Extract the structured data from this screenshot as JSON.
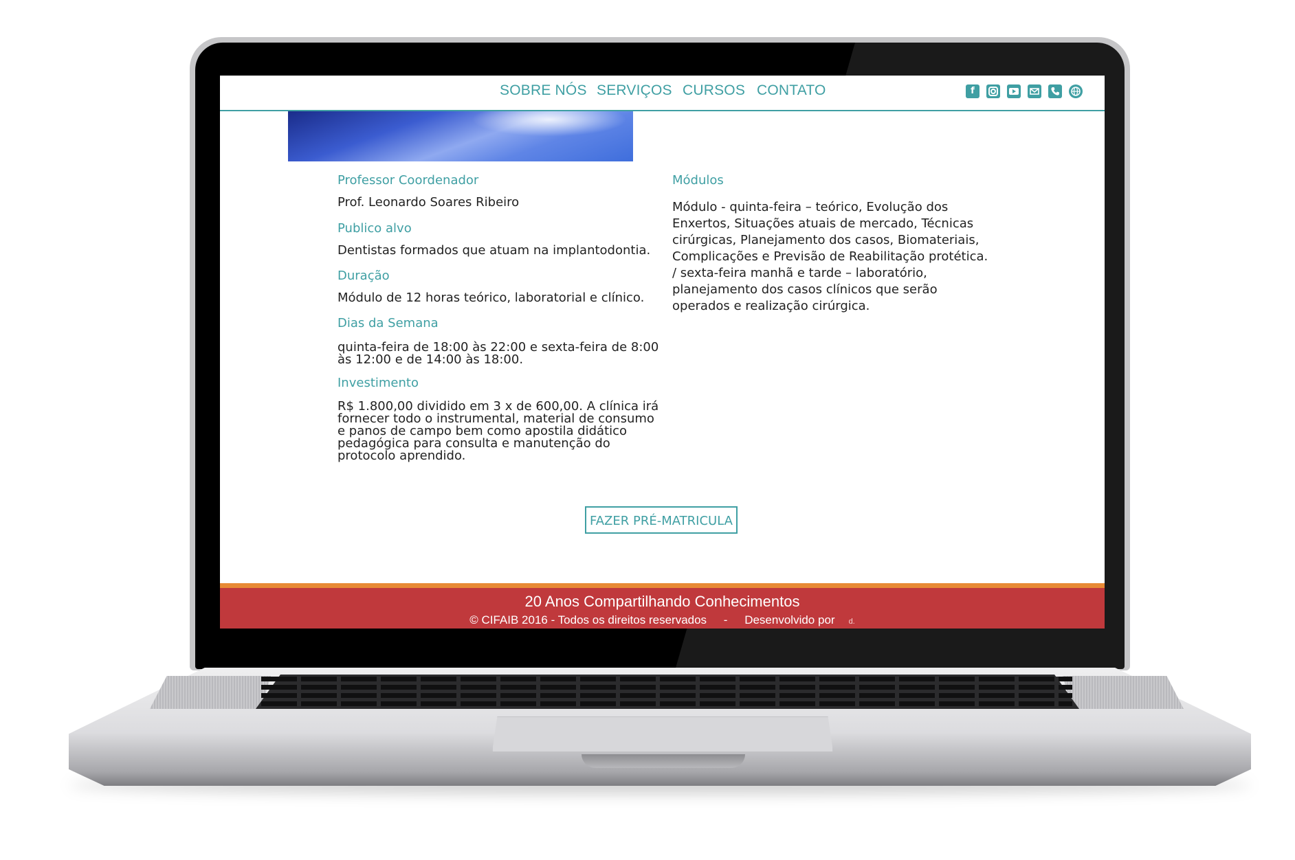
{
  "nav": {
    "links": [
      "SOBRE NÓS",
      "SERVIÇOS",
      "CURSOS",
      "CONTATO"
    ],
    "social_icons": [
      "facebook-icon",
      "instagram-icon",
      "youtube-icon",
      "email-icon",
      "phone-icon",
      "globe-icon"
    ]
  },
  "course": {
    "coordinator_label": "Professor Coordenador",
    "coordinator": "Prof. Leonardo Soares Ribeiro",
    "audience_label": "Publico alvo",
    "audience": "Dentistas formados que atuam na implantodontia.",
    "duration_label": "Duração",
    "duration": "Módulo de 12 horas teórico, laboratorial e clínico.",
    "days_label": "Dias da Semana",
    "days": "quinta-feira de 18:00 às 22:00 e sexta-feira de 8:00 às 12:00 e de 14:00 às 18:00.",
    "investment_label": "Investimento",
    "investment": "R$ 1.800,00 dividido em 3 x de 600,00. A clínica irá fornecer todo o instrumental, material de consumo e panos de campo bem como apostila didático pedagógica para consulta e manutenção do protocolo aprendido.",
    "modules_label": "Módulos",
    "modules": "Módulo - quinta-feira – teórico, Evolução dos Enxertos, Situações atuais de mercado, Técnicas cirúrgicas, Planejamento dos casos, Biomateriais, Complicações e Previsão de Reabilitação protética. / sexta-feira manhã e tarde – laboratório, planejamento dos casos clínicos que serão operados e realização cirúrgica."
  },
  "cta": {
    "label": "FAZER PRÉ-MATRICULA"
  },
  "footer": {
    "tagline": "20 Anos Compartilhando Conhecimentos",
    "copyright": "© CIFAIB 2016 - Todos os direitos reservados",
    "separator": "-",
    "developed_by": "Desenvolvido por",
    "developer_logo_text": "d."
  },
  "colors": {
    "accent": "#3f9fa3",
    "footer_red": "#c0393c",
    "footer_orange": "#e88a35"
  }
}
